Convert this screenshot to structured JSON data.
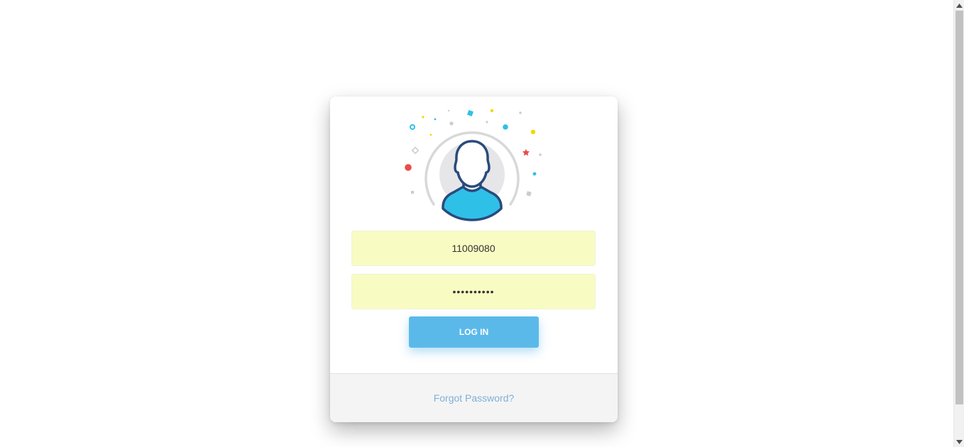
{
  "login": {
    "username_value": "11009080",
    "password_value": "••••••••••",
    "login_label": "LOG IN",
    "forgot_label": "Forgot Password?"
  },
  "colors": {
    "accent": "#5bb9ea",
    "input_bg": "#f8fcc3",
    "link": "#7fb0d6",
    "avatar_body": "#2fc0e8",
    "avatar_outline": "#2a4a7c"
  },
  "icons": {
    "avatar": "user-avatar-icon",
    "scroll_up": "scroll-up-icon",
    "scroll_down": "scroll-down-icon"
  }
}
